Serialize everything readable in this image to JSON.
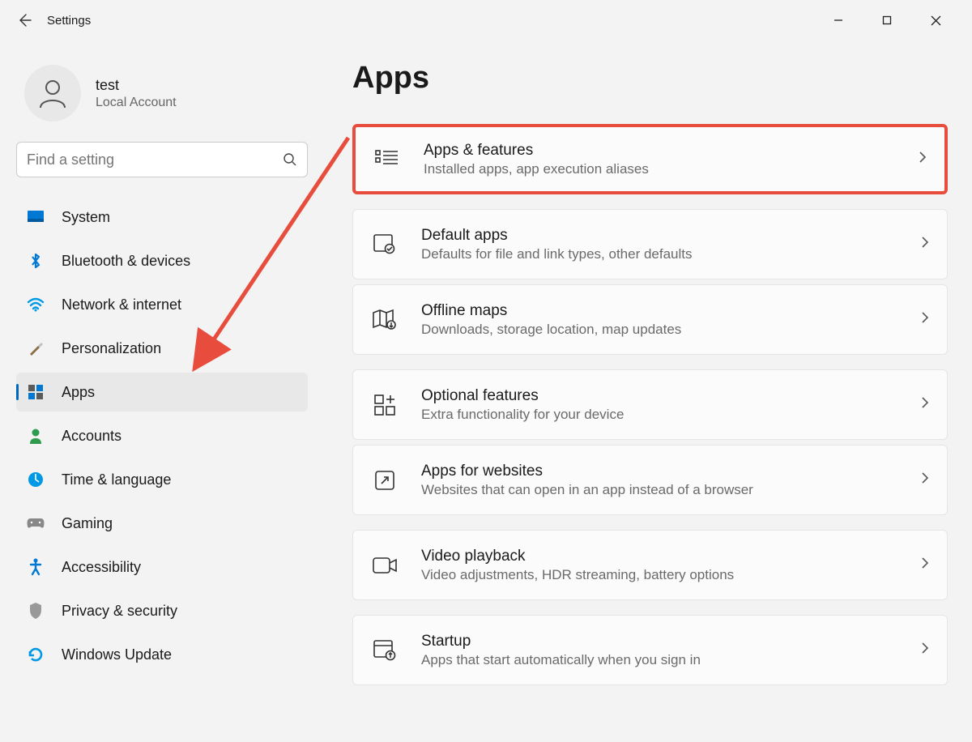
{
  "titlebar": {
    "title": "Settings"
  },
  "user": {
    "name": "test",
    "type": "Local Account"
  },
  "search": {
    "placeholder": "Find a setting"
  },
  "nav": [
    {
      "id": "system",
      "label": "System"
    },
    {
      "id": "bluetooth",
      "label": "Bluetooth & devices"
    },
    {
      "id": "network",
      "label": "Network & internet"
    },
    {
      "id": "personalization",
      "label": "Personalization"
    },
    {
      "id": "apps",
      "label": "Apps"
    },
    {
      "id": "accounts",
      "label": "Accounts"
    },
    {
      "id": "time",
      "label": "Time & language"
    },
    {
      "id": "gaming",
      "label": "Gaming"
    },
    {
      "id": "accessibility",
      "label": "Accessibility"
    },
    {
      "id": "privacy",
      "label": "Privacy & security"
    },
    {
      "id": "update",
      "label": "Windows Update"
    }
  ],
  "page": {
    "title": "Apps"
  },
  "cards": [
    {
      "id": "apps-features",
      "title": "Apps & features",
      "subtitle": "Installed apps, app execution aliases"
    },
    {
      "id": "default-apps",
      "title": "Default apps",
      "subtitle": "Defaults for file and link types, other defaults"
    },
    {
      "id": "offline-maps",
      "title": "Offline maps",
      "subtitle": "Downloads, storage location, map updates"
    },
    {
      "id": "optional-features",
      "title": "Optional features",
      "subtitle": "Extra functionality for your device"
    },
    {
      "id": "apps-websites",
      "title": "Apps for websites",
      "subtitle": "Websites that can open in an app instead of a browser"
    },
    {
      "id": "video-playback",
      "title": "Video playback",
      "subtitle": "Video adjustments, HDR streaming, battery options"
    },
    {
      "id": "startup",
      "title": "Startup",
      "subtitle": "Apps that start automatically when you sign in"
    }
  ]
}
